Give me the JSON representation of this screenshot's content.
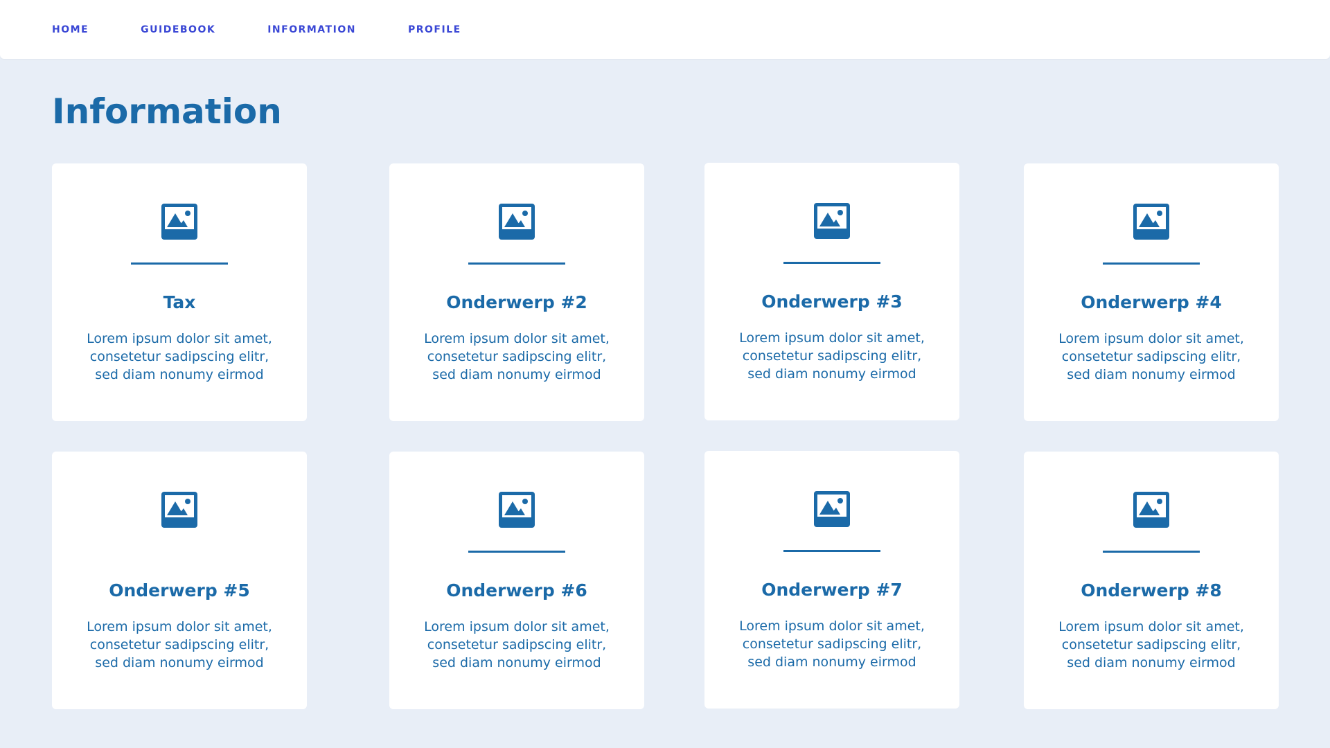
{
  "nav": {
    "items": [
      {
        "label": "HOME"
      },
      {
        "label": "GUIDEBOOK"
      },
      {
        "label": "INFORMATION"
      },
      {
        "label": "PROFILE"
      }
    ]
  },
  "page": {
    "title": "Information"
  },
  "colors": {
    "background": "#e8eef7",
    "nav_link": "#3a47d5",
    "accent": "#1b6aa8",
    "card": "#ffffff"
  },
  "cards": [
    {
      "icon": "image-icon",
      "title": "Tax",
      "text_lines": [
        "Lorem ipsum dolor sit amet,",
        "consetetur sadipscing elitr,",
        "sed diam nonumy eirmod"
      ]
    },
    {
      "icon": "image-icon",
      "title": "Onderwerp #2",
      "text_lines": [
        "Lorem ipsum dolor sit amet,",
        "consetetur sadipscing elitr,",
        "sed diam nonumy eirmod"
      ]
    },
    {
      "icon": "image-icon",
      "title": "Onderwerp #3",
      "text_lines": [
        "Lorem ipsum dolor sit amet,",
        "consetetur sadipscing elitr,",
        "sed diam nonumy eirmod"
      ]
    },
    {
      "icon": "image-icon",
      "title": "Onderwerp #4",
      "text_lines": [
        "Lorem ipsum dolor sit amet,",
        "consetetur sadipscing elitr,",
        "sed diam nonumy eirmod"
      ]
    },
    {
      "icon": "image-icon",
      "title": "Onderwerp #5",
      "text_lines": [
        "Lorem ipsum dolor sit amet,",
        "consetetur sadipscing elitr,",
        "sed diam nonumy eirmod"
      ]
    },
    {
      "icon": "image-icon",
      "title": "Onderwerp #6",
      "text_lines": [
        "Lorem ipsum dolor sit amet,",
        "consetetur sadipscing elitr,",
        "sed diam nonumy eirmod"
      ]
    },
    {
      "icon": "image-icon",
      "title": "Onderwerp #7",
      "text_lines": [
        "Lorem ipsum dolor sit amet,",
        "consetetur sadipscing elitr,",
        "sed diam nonumy eirmod"
      ]
    },
    {
      "icon": "image-icon",
      "title": "Onderwerp #8",
      "text_lines": [
        "Lorem ipsum dolor sit amet,",
        "consetetur sadipscing elitr,",
        "sed diam nonumy eirmod"
      ]
    }
  ]
}
